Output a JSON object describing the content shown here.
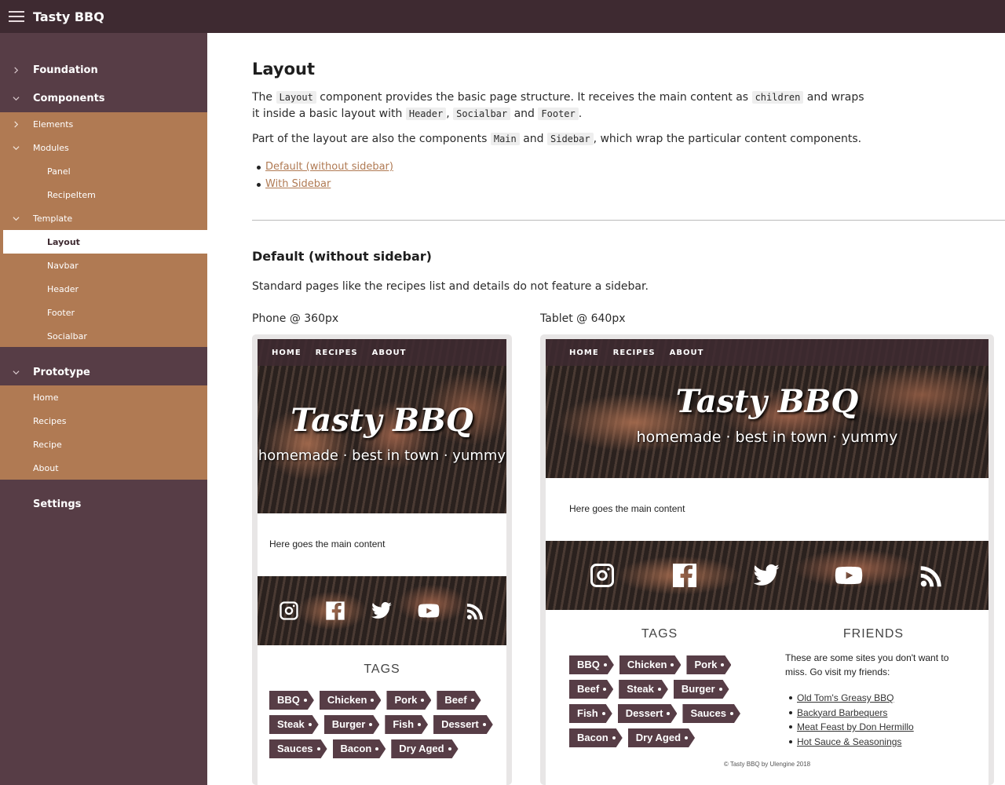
{
  "app": {
    "title": "Tasty BBQ"
  },
  "sidebar": {
    "foundation": "Foundation",
    "components": "Components",
    "elements": "Elements",
    "modules": "Modules",
    "panel": "Panel",
    "recipeitem": "RecipeItem",
    "template": "Template",
    "layout": "Layout",
    "navbar": "Navbar",
    "header": "Header",
    "footer": "Footer",
    "socialbar": "Socialbar",
    "prototype": "Prototype",
    "home": "Home",
    "recipes": "Recipes",
    "recipe": "Recipe",
    "about": "About",
    "settings": "Settings"
  },
  "main": {
    "title": "Layout",
    "intro": {
      "t1": "The ",
      "c1": "Layout",
      "t2": " component provides the basic page structure. It receives the main content as ",
      "c2": "children",
      "t3": " and wraps it inside a basic layout with ",
      "c3": "Header",
      "t4": ", ",
      "c4": "Socialbar",
      "t5": " and ",
      "c5": "Footer",
      "t6": "."
    },
    "intro2": {
      "t1": "Part of the layout are also the components ",
      "c1": "Main",
      "t2": " and ",
      "c2": "Sidebar",
      "t3": ", which wrap the particular content components."
    },
    "links": [
      "Default (without sidebar)",
      "With Sidebar"
    ],
    "section_title": "Default (without sidebar)",
    "section_desc": "Standard pages like the recipes list and details do not feature a sidebar.",
    "phone_label": "Phone @ 360px",
    "tablet_label": "Tablet @ 640px"
  },
  "preview": {
    "nav": [
      "HOME",
      "RECIPES",
      "ABOUT"
    ],
    "brand": "Tasty BBQ",
    "tagline": "homemade · best in town · yummy",
    "content": "Here goes the main content",
    "tags_title": "TAGS",
    "friends_title": "FRIENDS",
    "tags": [
      "BBQ",
      "Chicken",
      "Pork",
      "Beef",
      "Steak",
      "Burger",
      "Fish",
      "Dessert",
      "Sauces",
      "Bacon",
      "Dry Aged"
    ],
    "friends_text": "These are some sites you don't want to miss. Go visit my friends:",
    "friends": [
      "Old Tom's Greasy BBQ",
      "Backyard Barbequers",
      "Meat Feast by Don Hermillo",
      "Hot Sauce & Seasonings"
    ],
    "copyright": "© Tasty BBQ by Ulengine 2018"
  }
}
